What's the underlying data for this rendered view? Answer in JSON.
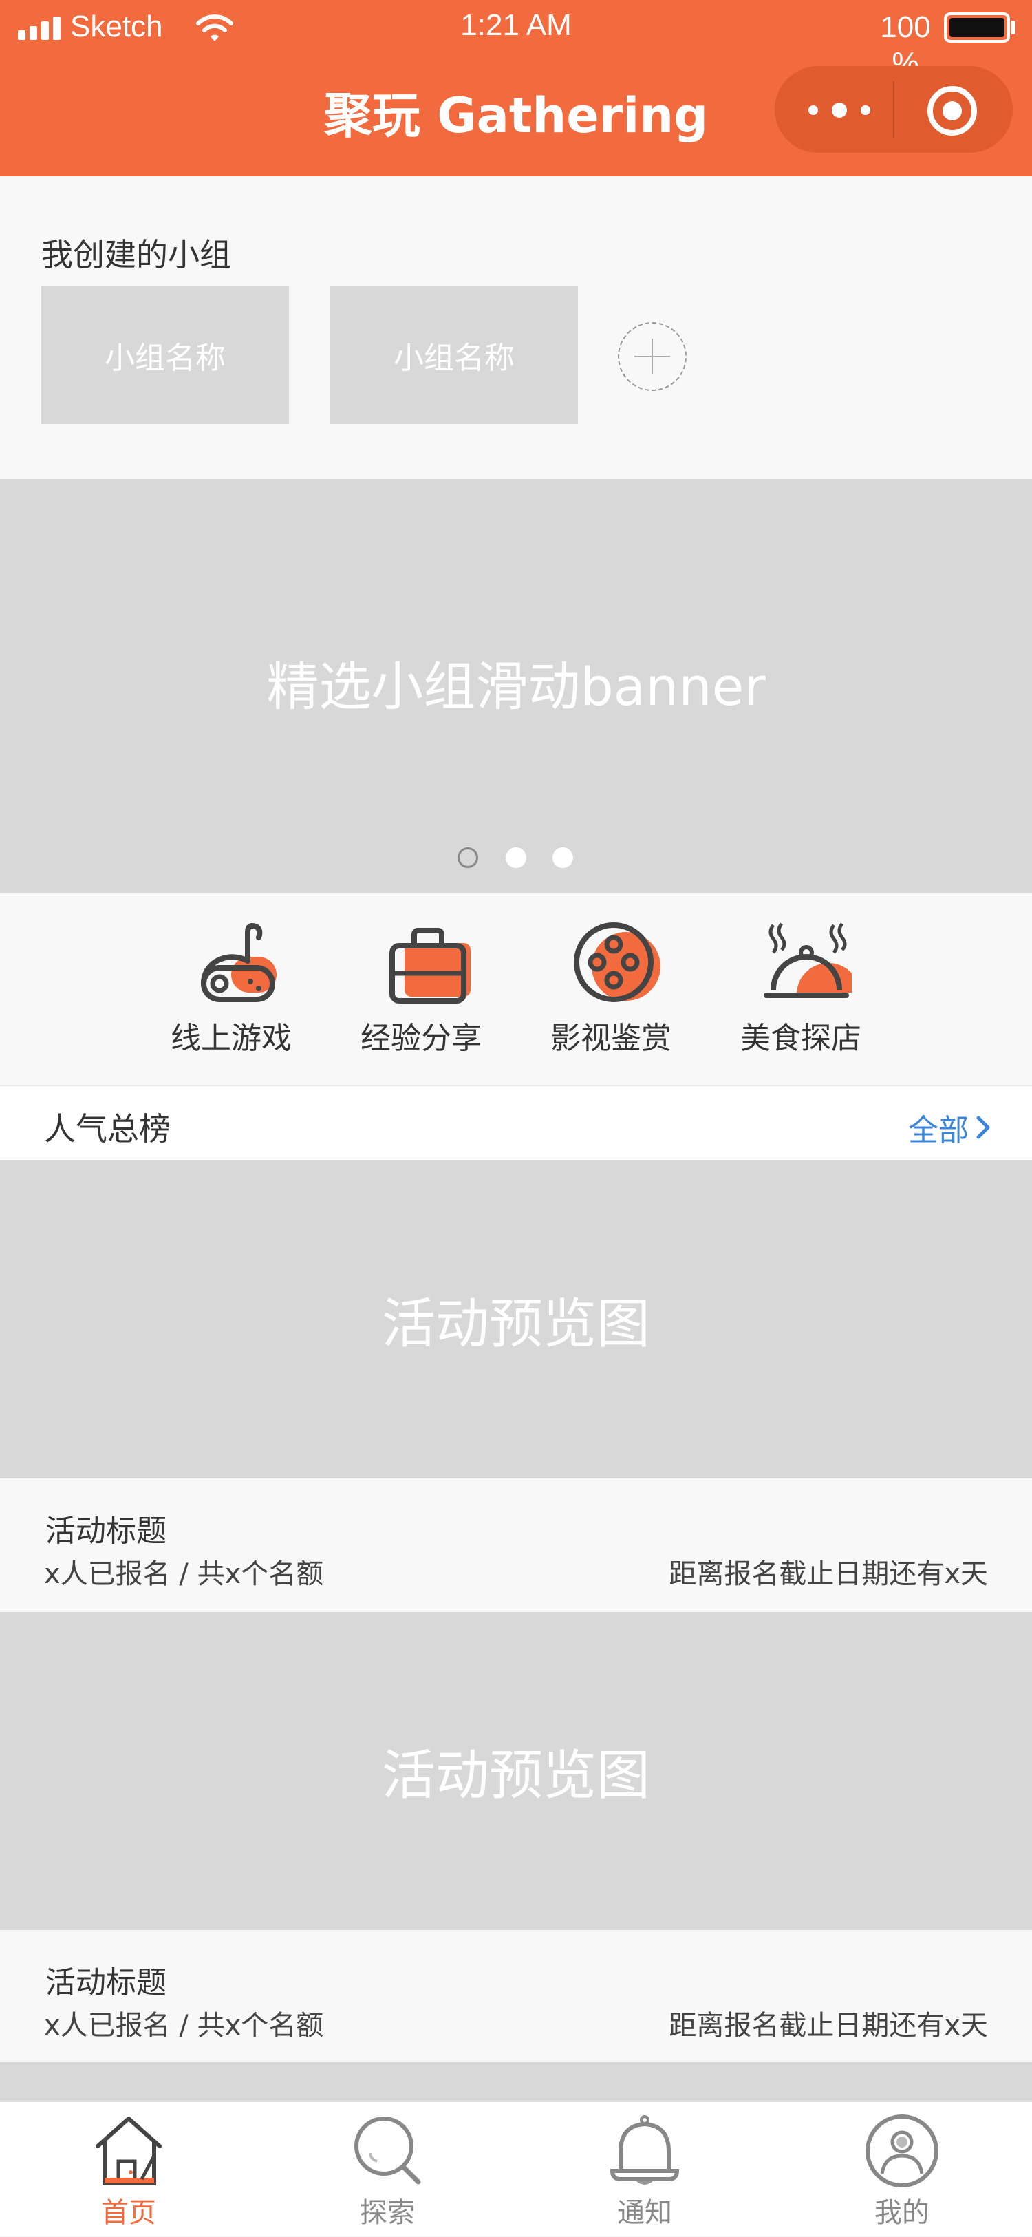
{
  "colors": {
    "accent": "#f26b3e",
    "placeholder": "#d8d8d8",
    "link": "#3b86d8",
    "text": "#333333"
  },
  "status_bar": {
    "carrier": "Sketch",
    "time": "1:21 AM",
    "battery": "100 %"
  },
  "header": {
    "title": "聚玩 Gathering",
    "more_icon": "more-dots-icon",
    "close_icon": "target-circle-icon"
  },
  "my_groups": {
    "title": "我创建的小组",
    "groups": [
      {
        "name": "小组名称"
      },
      {
        "name": "小组名称"
      }
    ],
    "add_icon": "plus-circle-icon"
  },
  "banner": {
    "text": "精选小组滑动banner",
    "pages": 3,
    "active_page": 1
  },
  "categories": [
    {
      "label": "线上游戏",
      "icon": "gamepad-icon"
    },
    {
      "label": "经验分享",
      "icon": "briefcase-icon"
    },
    {
      "label": "影视鉴赏",
      "icon": "film-reel-icon"
    },
    {
      "label": "美食探店",
      "icon": "food-dome-icon"
    }
  ],
  "ranking": {
    "title": "人气总榜",
    "all_label": "全部"
  },
  "activities": [
    {
      "image_text": "活动预览图",
      "title": "活动标题",
      "signups": "x人已报名 / 共x个名额",
      "deadline": "距离报名截止日期还有x天"
    },
    {
      "image_text": "活动预览图",
      "title": "活动标题",
      "signups": "x人已报名 / 共x个名额",
      "deadline": "距离报名截止日期还有x天"
    }
  ],
  "tabbar": {
    "tabs": [
      {
        "label": "首页",
        "icon": "home-icon",
        "active": true
      },
      {
        "label": "探索",
        "icon": "search-icon",
        "active": false
      },
      {
        "label": "通知",
        "icon": "bell-icon",
        "active": false
      },
      {
        "label": "我的",
        "icon": "user-icon",
        "active": false
      }
    ]
  }
}
